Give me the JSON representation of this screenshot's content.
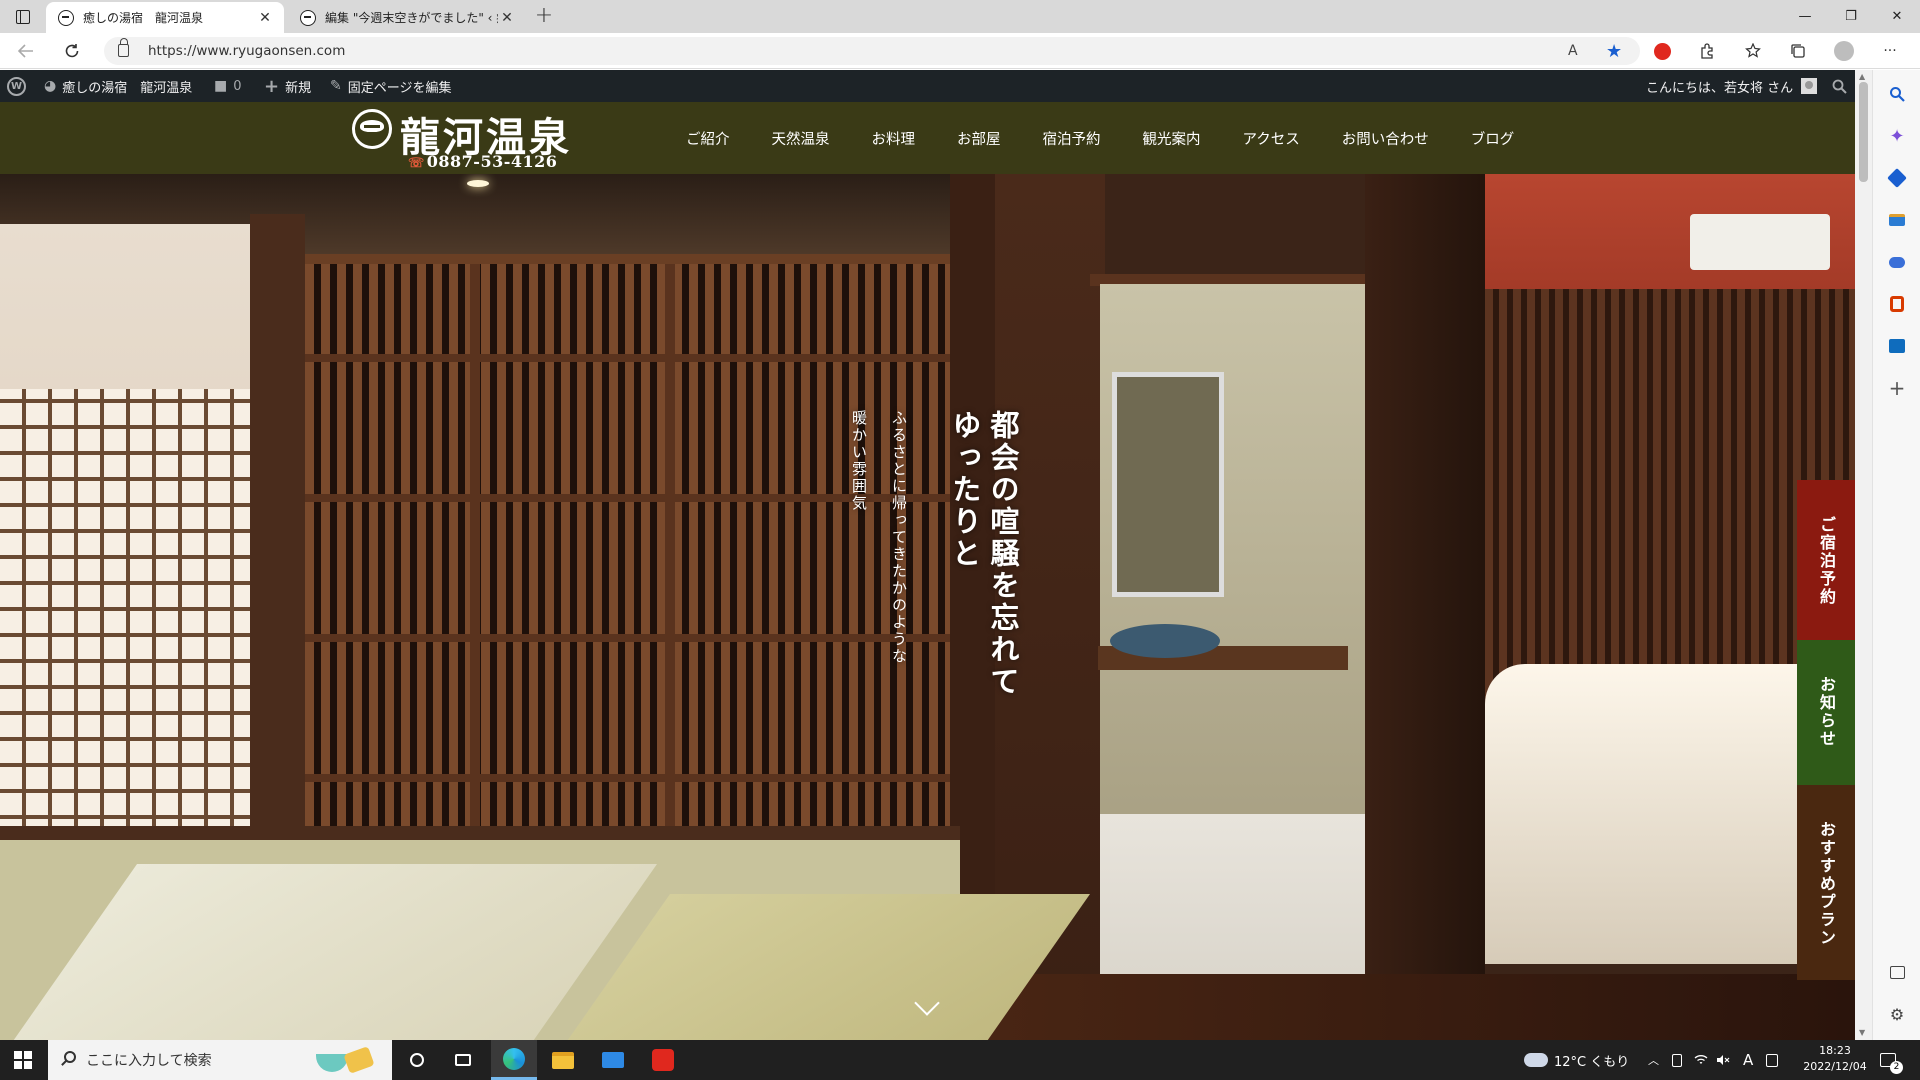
{
  "browser": {
    "tabs": [
      {
        "label": "癒しの湯宿　龍河温泉",
        "active": true
      },
      {
        "label": "編集 \"今週末空きがでました\" ‹ 癒し",
        "active": false
      }
    ],
    "tab_close": "✕",
    "new_tab": "+",
    "window_controls": {
      "minimize": "—",
      "restore": "❐",
      "close": "✕"
    },
    "url": "https://www.ryugaonsen.com",
    "read_aloud": "A",
    "favorite_star": "★",
    "menu": "···"
  },
  "wp_admin_bar": {
    "site_name": "癒しの湯宿　龍河温泉",
    "comments_count": "0",
    "new_label": "新規",
    "edit_label": "固定ページを編集",
    "greeting": "こんにちは、若女将 さん"
  },
  "site": {
    "logo_text": "龍河温泉",
    "phone": "0887-53-4126",
    "nav": [
      "ご紹介",
      "天然温泉",
      "お料理",
      "お部屋",
      "宿泊予約",
      "観光案内",
      "アクセス",
      "お問い合わせ",
      "ブログ"
    ],
    "hero": {
      "headline_line1": "都会の喧騒を忘れて",
      "headline_line2": "ゆったりと",
      "sub_line1": "ふるさとに帰ってきたかのような",
      "sub_line2": "暖かい雰囲気"
    },
    "side_tabs": [
      {
        "label": "ご宿泊予約",
        "color": "#8b1a10"
      },
      {
        "label": "お知らせ",
        "color": "#2f5a18"
      },
      {
        "label": "おすすめプラン",
        "color": "#4a2810"
      }
    ]
  },
  "taskbar": {
    "search_placeholder": "ここに入力して検索",
    "weather": "12°C くもり",
    "time": "18:23",
    "date": "2022/12/04",
    "ime": "A",
    "notifications_count": "2"
  },
  "colors": {
    "header_bg": "#3a3a16",
    "admin_bar_bg": "#1d2327",
    "taskbar_bg": "#202020"
  }
}
